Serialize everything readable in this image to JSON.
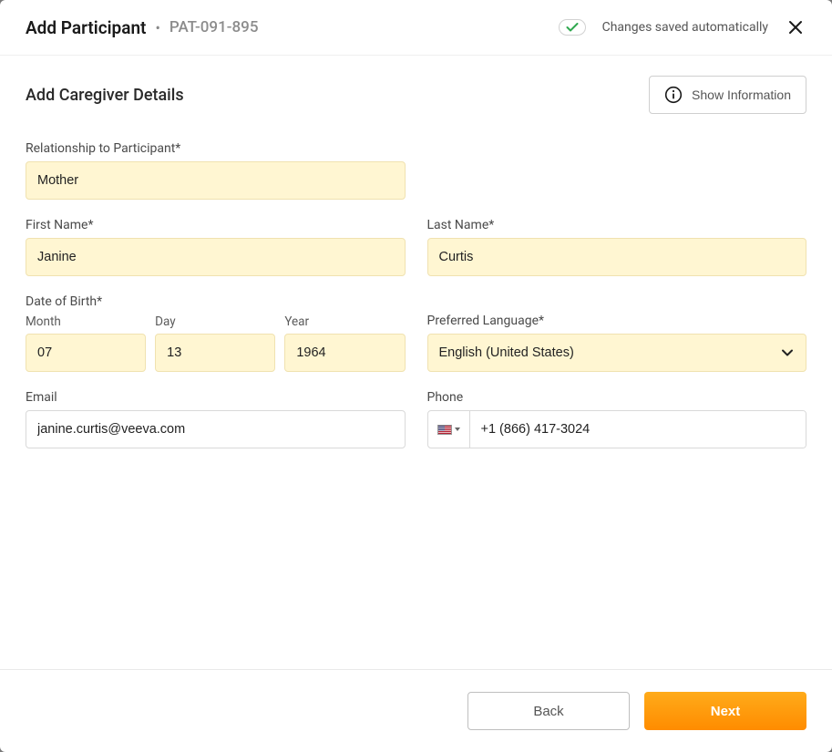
{
  "header": {
    "title": "Add Participant",
    "participant_id": "PAT-091-895",
    "save_status": "Changes saved automatically"
  },
  "section": {
    "title": "Add Caregiver Details",
    "show_info_label": "Show Information"
  },
  "form": {
    "relationship": {
      "label": "Relationship to Participant*",
      "value": "Mother"
    },
    "first_name": {
      "label": "First Name*",
      "value": "Janine"
    },
    "last_name": {
      "label": "Last Name*",
      "value": "Curtis"
    },
    "dob": {
      "label": "Date of Birth*",
      "month_label": "Month",
      "month": "07",
      "day_label": "Day",
      "day": "13",
      "year_label": "Year",
      "year": "1964"
    },
    "preferred_language": {
      "label": "Preferred Language*",
      "value": "English (United States)"
    },
    "email": {
      "label": "Email",
      "value": "janine.curtis@veeva.com"
    },
    "phone": {
      "label": "Phone",
      "value": "+1 (866) 417-3024",
      "country": "US"
    }
  },
  "footer": {
    "back_label": "Back",
    "next_label": "Next"
  }
}
